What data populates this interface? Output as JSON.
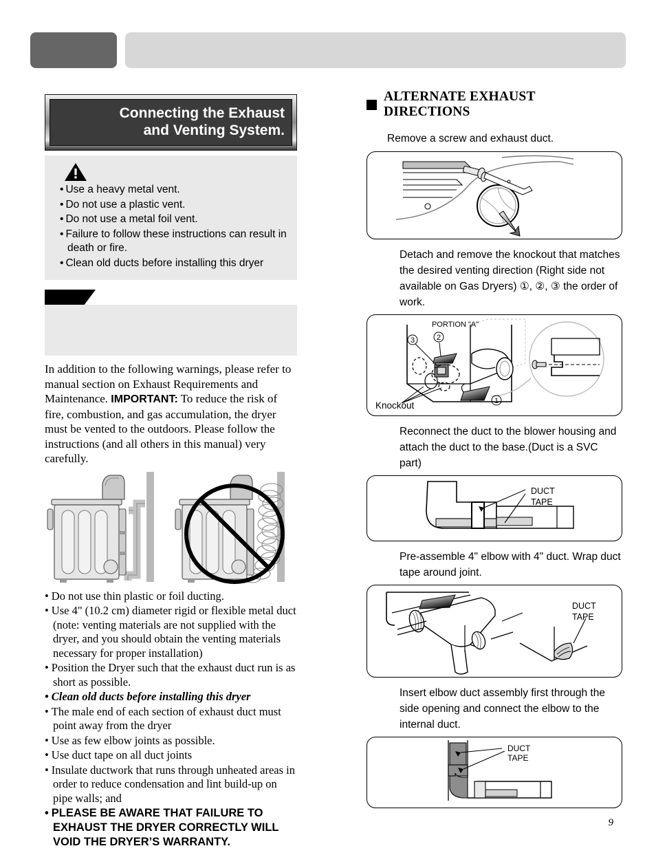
{
  "header": {
    "tab_label": "",
    "bar_label": ""
  },
  "left": {
    "title_line1": "Connecting the Exhaust",
    "title_line2": "and Venting System.",
    "warning": {
      "icon": "warning-triangle-icon",
      "bullet": "•",
      "items": [
        "Use a heavy metal vent.",
        "Do not use a plastic vent.",
        "Do not use a metal foil vent.",
        "Failure to follow these instructions can result in death or fire.",
        "Clean old ducts before installing this dryer"
      ]
    },
    "note_box": {
      "tab_label": "",
      "body_text": ""
    },
    "paragraph": {
      "part1": "In addition to the following warnings, please refer to manual section on Exhaust Requirements and Maintenance. ",
      "emphasis": "IMPORTANT:",
      "part2": "  To reduce the risk of fire, combustion, and gas accumulation, the dryer must be vented to the outdoors.  Please follow the instructions (and all others in this manual) very carefully."
    },
    "figures": {
      "dryer_correct": "dryer-rigid-duct-correct",
      "dryer_incorrect": "dryer-flexible-duct-prohibited"
    },
    "bullets": [
      {
        "text": "Do not use thin plastic or foil ducting.",
        "style": "normal"
      },
      {
        "text": "Use 4\" (10.2 cm) diameter rigid or flexible metal duct (note:  venting materials are not supplied with the dryer, and you should obtain the venting materials necessary for proper installation)",
        "style": "normal"
      },
      {
        "text": "Position the Dryer such that the exhaust duct run is as short as possible.",
        "style": "normal"
      },
      {
        "text": "Clean old ducts before installing this dryer",
        "style": "bold-italic"
      },
      {
        "text": "The male end of each section of exhaust duct must point away from the dryer",
        "style": "normal"
      },
      {
        "text": "Use as few elbow joints as possible.",
        "style": "normal"
      },
      {
        "text": "Use duct tape on all duct joints",
        "style": "normal"
      },
      {
        "text": "Insulate ductwork that runs through unheated areas in order to reduce condensation and lint build-up on pipe walls; and",
        "style": "normal"
      },
      {
        "text": "PLEASE BE AWARE THAT FAILURE TO EXHAUST THE DRYER CORRECTLY WILL VOID THE DRYER’S WARRANTY.",
        "style": "caps-bold"
      }
    ]
  },
  "right": {
    "section_title": "ALTERNATE EXHAUST DIRECTIONS",
    "steps": [
      {
        "text": "Remove a screw and exhaust duct.",
        "figure": "screw-and-exhaust-duct-removal-figure"
      },
      {
        "text": "Detach and remove the knockout that matches the desired venting direction (Right side not available on Gas Dryers) ①, ②, ③ the order of work.",
        "figure": "knockout-portion-a-figure"
      },
      {
        "text": "Reconnect the duct to the blower housing and attach the duct to the base.(Duct is a SVC part)",
        "figure": "duct-to-blower-housing-figure"
      },
      {
        "text": "Pre-assemble 4\" elbow with 4\" duct. Wrap duct tape around joint.",
        "figure": "elbow-duct-pre-assembly-figure"
      },
      {
        "text": "Insert elbow duct assembly first through the side opening and connect the elbow to the internal duct.",
        "figure": "elbow-insertion-figure"
      }
    ],
    "figure_labels": {
      "portion_a": "PORTION \"A\"",
      "knockout": "Knockout",
      "duct_tape_line1": "DUCT",
      "duct_tape_line2": "TAPE",
      "marker1": "①",
      "marker2": "②",
      "marker3": "③"
    }
  },
  "page_number": "9"
}
